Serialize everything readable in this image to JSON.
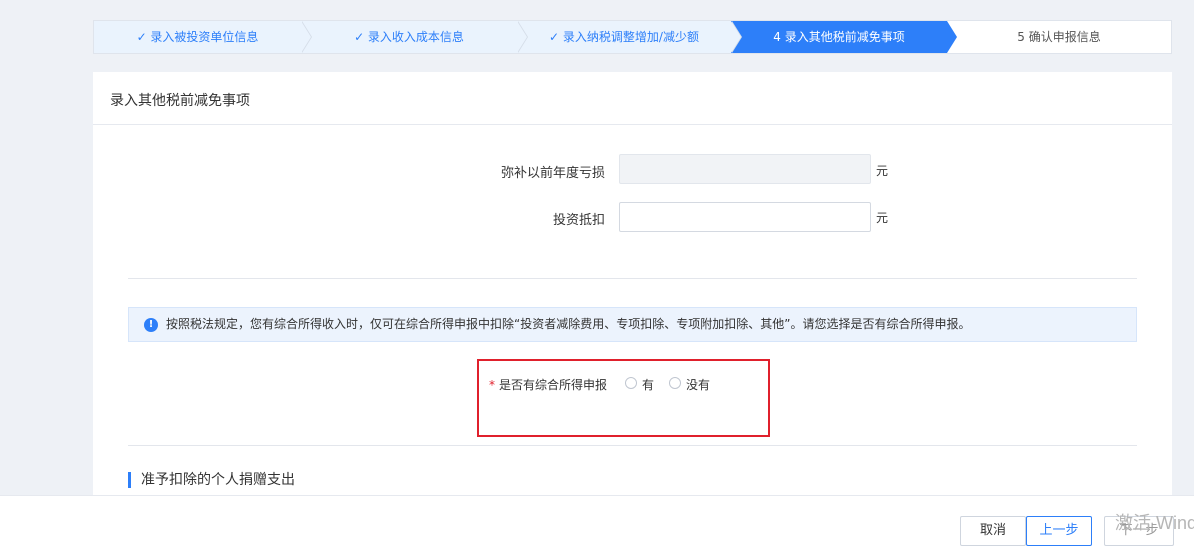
{
  "steps": [
    {
      "label": "✓ 录入被投资单位信息",
      "state": "done"
    },
    {
      "label": "✓ 录入收入成本信息",
      "state": "done"
    },
    {
      "label": "✓ 录入纳税调整增加/减少额",
      "state": "done"
    },
    {
      "label": "4 录入其他税前减免事项",
      "state": "active"
    },
    {
      "label": "5 确认申报信息",
      "state": "pending"
    }
  ],
  "panel": {
    "title": "录入其他税前减免事项",
    "fields": [
      {
        "label": "弥补以前年度亏损",
        "value": "",
        "unit": "元",
        "disabled": true
      },
      {
        "label": "投资抵扣",
        "value": "",
        "unit": "元",
        "disabled": false
      }
    ],
    "notice": "按照税法规定，您有综合所得收入时，仅可在综合所得申报中扣除“投资者减除费用、专项扣除、专项附加扣除、其他”。请您选择是否有综合所得申报。",
    "question": {
      "required_mark": "*",
      "label": "是否有综合所得申报",
      "options": [
        "有",
        "没有"
      ]
    },
    "section_title": "准予扣除的个人捐赠支出"
  },
  "footer": {
    "cancel": "取消",
    "prev": "上一步",
    "next": "下一步"
  },
  "watermark": "激活 Windows",
  "colors": {
    "accent": "#2d7ff9",
    "highlight": "#e0202c"
  }
}
